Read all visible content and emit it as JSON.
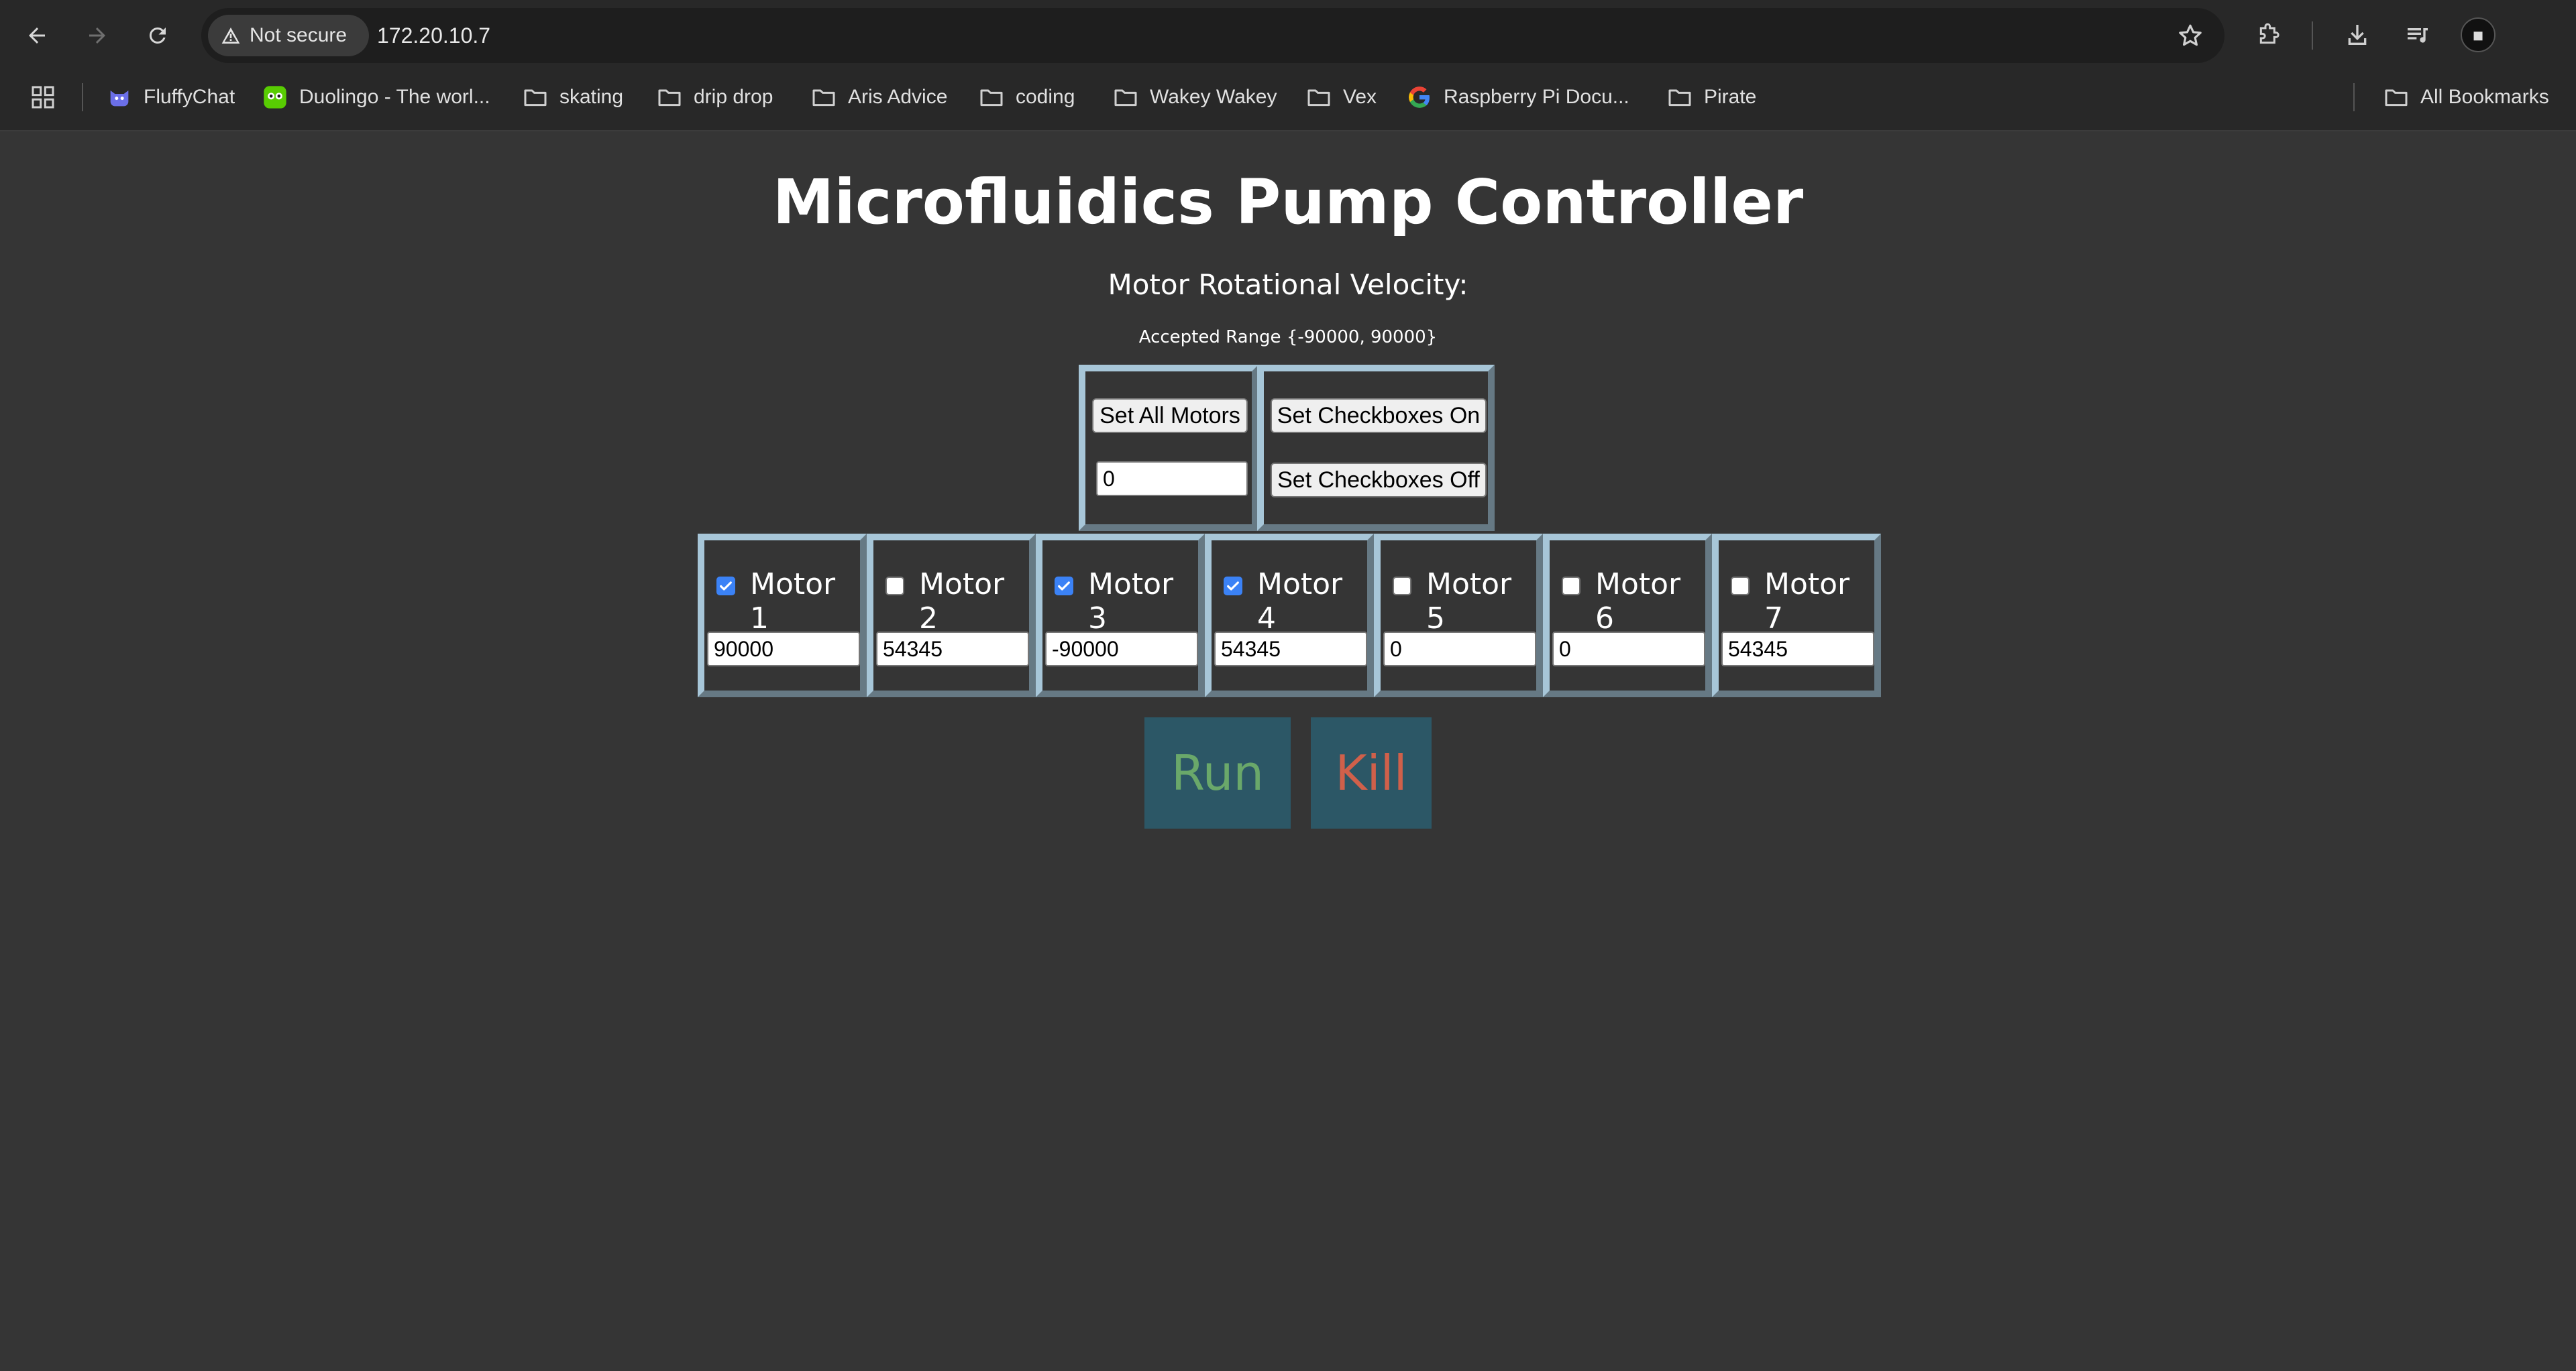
{
  "browser": {
    "security_label": "Not secure",
    "url": "172.20.10.7",
    "bookmarks": [
      {
        "label": "FluffyChat",
        "icon": "fluffychat-icon"
      },
      {
        "label": "Duolingo - The worl...",
        "icon": "duolingo-icon"
      },
      {
        "label": "skating",
        "icon": "folder-icon"
      },
      {
        "label": "drip drop",
        "icon": "folder-icon"
      },
      {
        "label": "Aris Advice",
        "icon": "folder-icon"
      },
      {
        "label": "coding",
        "icon": "folder-icon"
      },
      {
        "label": "Wakey Wakey",
        "icon": "folder-icon"
      },
      {
        "label": "Vex",
        "icon": "folder-icon"
      },
      {
        "label": "Raspberry Pi Docu...",
        "icon": "google-icon"
      },
      {
        "label": "Pirate",
        "icon": "folder-icon"
      }
    ],
    "all_bookmarks_label": "All Bookmarks"
  },
  "page": {
    "title": "Microfluidics Pump Controller",
    "subtitle": "Motor Rotational Velocity:",
    "range_note": "Accepted Range {-90000, 90000}",
    "set_all_label": "Set All Motors",
    "set_all_value": "0",
    "checkboxes_on_label": "Set Checkboxes On",
    "checkboxes_off_label": "Set Checkboxes Off",
    "motors": [
      {
        "label": "Motor 1",
        "checked": true,
        "value": "90000"
      },
      {
        "label": "Motor 2",
        "checked": false,
        "value": "54345"
      },
      {
        "label": "Motor 3",
        "checked": true,
        "value": "-90000"
      },
      {
        "label": "Motor 4",
        "checked": true,
        "value": "54345"
      },
      {
        "label": "Motor 5",
        "checked": false,
        "value": "0"
      },
      {
        "label": "Motor 6",
        "checked": false,
        "value": "0"
      },
      {
        "label": "Motor 7",
        "checked": false,
        "value": "54345"
      }
    ],
    "run_label": "Run",
    "kill_label": "Kill",
    "run_color": "#6aa86a",
    "kill_color": "#d0604a",
    "accent_color": "#3b82f6"
  }
}
